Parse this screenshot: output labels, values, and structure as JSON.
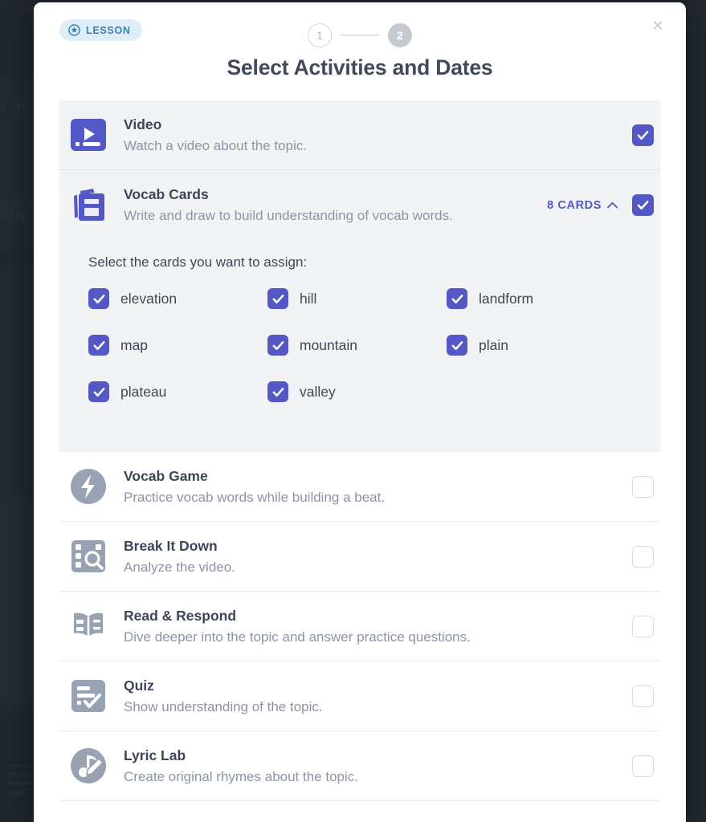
{
  "modal": {
    "badge": {
      "label": "LESSON",
      "icon": "star-circle-icon",
      "bg": "#ddeef8",
      "fg": "#3c7fb1"
    },
    "steps": {
      "step1": "1",
      "step2": "2",
      "current": 2
    },
    "title": "Select Activities and Dates",
    "close_label": "×",
    "accent": "#5358c4",
    "muted_icon_color": "#98a2b3"
  },
  "activities": [
    {
      "name": "Video",
      "description": "Watch a video about the topic.",
      "icon": "video-icon",
      "icon_style": "purple",
      "checked": true,
      "selected": true
    },
    {
      "name": "Vocab Cards",
      "description": "Write and draw to build understanding of vocab words.",
      "icon": "vocab-cards-icon",
      "icon_style": "purple",
      "checked": true,
      "selected": true,
      "count_label": "8 CARDS",
      "expanded": true
    },
    {
      "name": "Vocab Game",
      "description": "Practice vocab words while building a beat.",
      "icon": "lightning-bolt-icon",
      "icon_style": "gray-circle",
      "checked": false,
      "selected": false
    },
    {
      "name": "Break It Down",
      "description": "Analyze the video.",
      "icon": "film-search-icon",
      "icon_style": "gray-square",
      "checked": false,
      "selected": false
    },
    {
      "name": "Read & Respond",
      "description": "Dive deeper into the topic and answer practice questions.",
      "icon": "open-book-icon",
      "icon_style": "gray-square",
      "checked": false,
      "selected": false
    },
    {
      "name": "Quiz",
      "description": "Show understanding of the topic.",
      "icon": "quiz-checklist-icon",
      "icon_style": "gray-square",
      "checked": false,
      "selected": false
    },
    {
      "name": "Lyric Lab",
      "description": "Create original rhymes about the topic.",
      "icon": "music-note-pencil-icon",
      "icon_style": "gray-circle",
      "checked": false,
      "selected": false
    }
  ],
  "vocab_picker": {
    "prompt": "Select the cards you want to assign:",
    "cards": [
      {
        "word": "elevation",
        "checked": true
      },
      {
        "word": "hill",
        "checked": true
      },
      {
        "word": "landform",
        "checked": true
      },
      {
        "word": "map",
        "checked": true
      },
      {
        "word": "mountain",
        "checked": true
      },
      {
        "word": "plain",
        "checked": true
      },
      {
        "word": "plateau",
        "checked": true
      },
      {
        "word": "valley",
        "checked": true
      }
    ]
  },
  "background": {
    "faint_text_1": "D ORI",
    "faint_text_2": "IGN"
  }
}
